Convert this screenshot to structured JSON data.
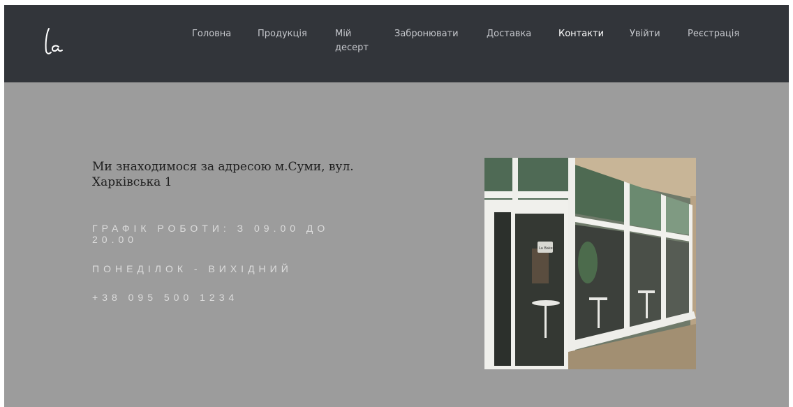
{
  "nav": {
    "items": [
      {
        "label": "Головна",
        "active": false
      },
      {
        "label": "Продукція",
        "active": false
      },
      {
        "label": "Мій десерт",
        "active": false
      },
      {
        "label": "Забронювати",
        "active": false
      },
      {
        "label": "Доставка",
        "active": false
      },
      {
        "label": "Контакти",
        "active": true
      },
      {
        "label": "Увійти",
        "active": false
      },
      {
        "label": "Реєстрація",
        "active": false
      }
    ]
  },
  "contact": {
    "address": "Ми знаходимося за адресою м.Суми, вул. Харківська 1",
    "schedule": "ГРАФІК РОБОТИ: З 09.00 ДО 20.00",
    "day_off": "ПОНЕДІЛОК - ВИХІДНИЙ",
    "phone": "+38 095 500 1234"
  },
  "photo": {
    "icon": "cafe-storefront-photo",
    "sign": "La Bakery"
  },
  "colors": {
    "navbar_bg": "#32353a",
    "content_bg": "#9c9c9c",
    "nav_text": "#c5c7cc",
    "nav_active": "#ffffff"
  }
}
